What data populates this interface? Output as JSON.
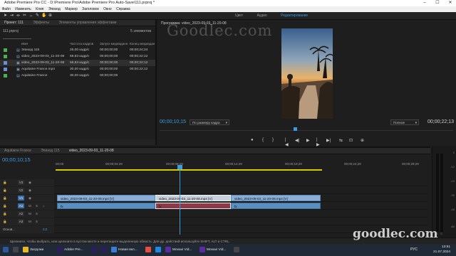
{
  "window": {
    "title": "Adobe Premiere Pro CC - D:\\Premiere Pro\\Adobe Premiere Pro Auto-Save\\111.prproj *",
    "controls": [
      "–",
      "☐",
      "✕"
    ]
  },
  "menu": [
    "Файл",
    "Изменить",
    "Клип",
    "Эпизод",
    "Маркер",
    "Заголовок",
    "Окно",
    "Справка"
  ],
  "workspaces": {
    "items": [
      "Цвет",
      "Аудио",
      "Редактирование"
    ],
    "active_index": 2
  },
  "project_panel": {
    "tabs": [
      "Проект: 111",
      "Эффекты",
      "Элементы управления эффектами"
    ],
    "active_tab": 0,
    "file": "111.prproj",
    "count": "5 элементов",
    "columns": [
      "Имя",
      "Частота кадров",
      "Запуск медиаданн",
      "Конец медиадан"
    ],
    "rows": [
      {
        "name": "Эпизод 115",
        "fps": "25,00 кадр/с",
        "start": "00;00;00;00",
        "end": "00;00;24;24",
        "color": "#4caf50",
        "icon": "sequence-icon"
      },
      {
        "name": "video_2023-09-03_11-20-08",
        "fps": "59,83 кадр/с",
        "start": "00;00;00;00",
        "end": "00;00;22;12",
        "color": "#4caf50",
        "icon": "sequence-icon"
      },
      {
        "name": "video_2023-09-03_11-20-08",
        "fps": "59,83 кадр/с",
        "start": "00;00;00;00",
        "end": "00;00;22;12",
        "color": "#6d8fcf",
        "icon": "video-clip-icon"
      },
      {
        "name": "Aquitaine France.mp4",
        "fps": "30,00 кадр/с",
        "start": "00;00;00;00",
        "end": "00;00;22;12",
        "color": "#6d8fcf",
        "icon": "video-clip-icon"
      },
      {
        "name": "Aquitaine France",
        "fps": "30,00 кадр/с",
        "start": "00;00;00;00",
        "end": "",
        "color": "#4caf50",
        "icon": "sequence-icon"
      }
    ]
  },
  "program_monitor": {
    "title": "Программа: video_2023-09-03_11-20-08",
    "timecode_left": "00;00;10;15",
    "fit": "По размеру кадра",
    "quality": "Полное",
    "timecode_right": "00;00;22;13",
    "transport": [
      "●",
      "{",
      "}",
      "|◀",
      "◀|",
      "▶",
      "|▶",
      "▶|",
      "⇆",
      "⊡",
      "⊕"
    ]
  },
  "timeline": {
    "tabs": [
      "Aquitaine France",
      "Эпизод 115",
      "video_2023-09-03_11-20-08"
    ],
    "active_tab": 2,
    "timecode": "00;00;10;15",
    "ruler": [
      "00;00",
      "00;00;04;29",
      "00;00;09;29",
      "00;00;14;29",
      "00;00;19;29",
      "00;00;24;29",
      "00;00;29;29"
    ],
    "tracks": {
      "video": [
        "V3",
        "V2",
        "V1"
      ],
      "audio": [
        "A1",
        "A2",
        "A3"
      ],
      "master": "Основ...",
      "master_level": "0,0"
    },
    "clips": {
      "v1": [
        "video_2023-09-03_11-20-08.mp4 [V]",
        "video_2023-09-03_11-20-08.mp4 [V]",
        "video_2023-09-03_11-20-08.mp4 [V]"
      ],
      "a1": [
        "fx",
        "fx",
        "fx"
      ]
    }
  },
  "meters": {
    "labels": [
      "0",
      "-12",
      "-24",
      "-36",
      "-48",
      "dB"
    ],
    "channels": [
      "S",
      "S"
    ]
  },
  "status": "Щелкните, чтобы выбрать, или щелкните в пустом месте и перетащите выделенную область. Для др. действий используйте SHIFT, ALT и CTRL.",
  "taskbar": {
    "items": [
      {
        "label": "",
        "color": "#2b5797"
      },
      {
        "label": "",
        "color": "#444"
      },
      {
        "label": "Загрузки",
        "color": "#e8b923"
      },
      {
        "label": "Adobe Pre...",
        "color": "#2a1f5c"
      },
      {
        "label": "",
        "color": "#2a1f5c"
      },
      {
        "label": "",
        "color": "#2a1f5c"
      },
      {
        "label": "Новая вкл...",
        "color": "#3a7bd5"
      },
      {
        "label": "",
        "color": "#e94e3c"
      },
      {
        "label": "",
        "color": "#1e88e5"
      },
      {
        "label": "Movavi Vid...",
        "color": "#5b2ca0"
      },
      {
        "label": "Movavi Vid...",
        "color": "#5b2ca0"
      },
      {
        "label": "",
        "color": "#444"
      }
    ],
    "language": "РУС",
    "time": "13:51",
    "date": "21.07.2024"
  },
  "watermark": {
    "top": "Goodlec.com",
    "bottom": "goodlec.com"
  }
}
